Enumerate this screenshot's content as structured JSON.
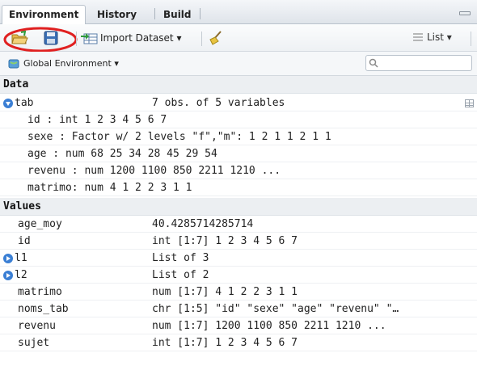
{
  "tabs": [
    {
      "label": "Environment",
      "active": true
    },
    {
      "label": "History",
      "active": false
    },
    {
      "label": "Build",
      "active": false
    }
  ],
  "toolbar": {
    "import_label": "Import Dataset ▾",
    "view_label": "List ▾",
    "highlight_color": "#e02020"
  },
  "env": {
    "scope_label": "Global Environment ▾",
    "search_placeholder": ""
  },
  "data_section": {
    "header": "Data",
    "tab": {
      "name": "tab",
      "value": "7 obs. of 5 variables"
    },
    "fields": [
      "id : int 1 2 3 4 5 6 7",
      "sexe : Factor w/ 2 levels \"f\",\"m\": 1 2 1 1 2 1 1",
      "age : num 68 25 34 28 45 29 54",
      "revenu : num 1200 1100 850 2211 1210 ...",
      "matrimo: num 4 1 2 2 3 1 1"
    ]
  },
  "values_section": {
    "header": "Values",
    "rows": [
      {
        "name": "age_moy",
        "value": "40.4285714285714"
      },
      {
        "name": "id",
        "value": "int [1:7] 1 2 3 4 5 6 7"
      },
      {
        "name": "l1",
        "value": "List of 3"
      },
      {
        "name": "l2",
        "value": "List of 2"
      },
      {
        "name": "matrimo",
        "value": "num [1:7] 4 1 2 2 3 1 1"
      },
      {
        "name": "noms_tab",
        "value": "chr [1:5] \"id\" \"sexe\" \"age\" \"revenu\" \"…"
      },
      {
        "name": "revenu",
        "value": "num [1:7] 1200 1100 850 2211 1210 ..."
      },
      {
        "name": "sujet",
        "value": "int [1:7] 1 2 3 4 5 6 7"
      }
    ]
  }
}
